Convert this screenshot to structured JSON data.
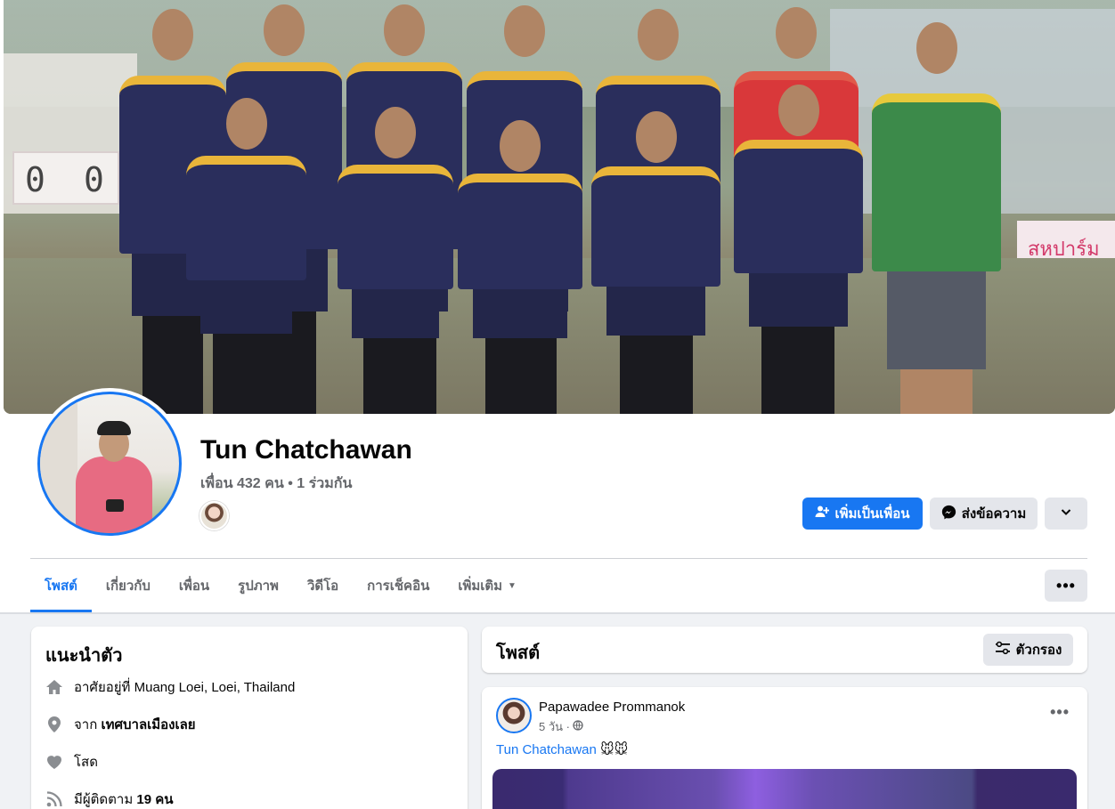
{
  "profile": {
    "name": "Tun Chatchawan",
    "friends_summary": "เพื่อน 432 คน • 1 ร่วมกัน"
  },
  "actions": {
    "add_friend_label": "เพิ่มเป็นเพื่อน",
    "message_label": "ส่งข้อความ"
  },
  "cover": {
    "score_left": "0",
    "score_right": "0",
    "banner_text": "สหปาร์ม"
  },
  "tabs": [
    {
      "label": "โพสต์",
      "active": true
    },
    {
      "label": "เกี่ยวกับ"
    },
    {
      "label": "เพื่อน"
    },
    {
      "label": "รูปภาพ"
    },
    {
      "label": "วิดีโอ"
    },
    {
      "label": "การเช็คอิน"
    },
    {
      "label": "เพิ่มเติม"
    }
  ],
  "intro": {
    "title": "แนะนำตัว",
    "lives_prefix": "อาศัยอยู่ที่",
    "lives_value": "Muang Loei, Loei, Thailand",
    "from_prefix": "จาก",
    "from_value": "เทศบาลเมืองเลย",
    "relationship": "โสด",
    "followers_prefix": "มีผู้ติดตาม",
    "followers_value": "19 คน"
  },
  "posts": {
    "title": "โพสต์",
    "filter_label": "ตัวกรอง"
  },
  "post": {
    "author": "Papawadee Prommanok",
    "time": "5 วัน ·",
    "tag_name": "Tun Chatchawan",
    "tag_emoji": "🐭🐭"
  },
  "colors": {
    "accent": "#1877f2",
    "page_bg": "#f0f2f5",
    "secondary_button": "#e4e6eb",
    "muted_text": "#65676b"
  },
  "icons": {
    "add_friend": "person-plus-icon",
    "message": "messenger-icon",
    "dropdown": "chevron-down-icon",
    "more": "ellipsis-icon",
    "home": "home-icon",
    "location": "location-pin-icon",
    "heart": "heart-icon",
    "followers": "rss-icon",
    "filter": "sliders-icon",
    "privacy": "globe-icon"
  }
}
